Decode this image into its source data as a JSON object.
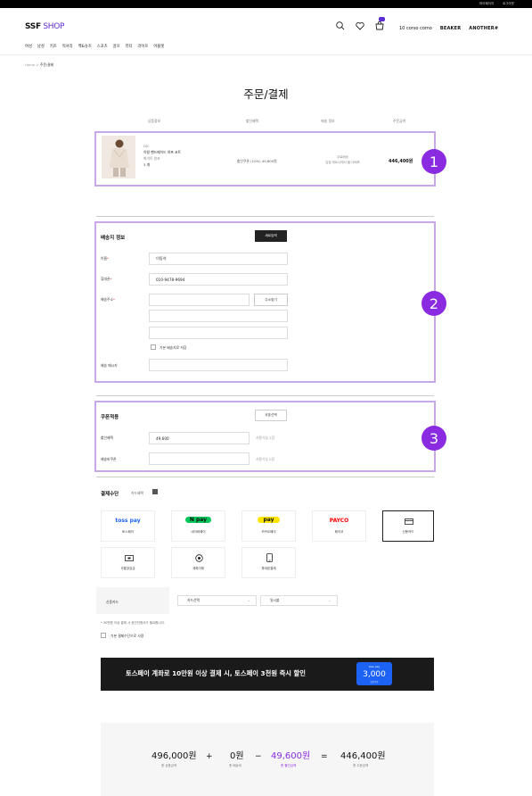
{
  "topbar": {
    "my_page": "마이페이지",
    "logout": "로그아웃"
  },
  "header": {
    "logo_bold": "SSF",
    "logo_light": " SHOP",
    "icons": [
      "search-icon",
      "heart-icon",
      "cart-icon"
    ],
    "brands": [
      "10 corso como",
      "BEAKER",
      "ANOTHER#"
    ]
  },
  "nav": [
    "여성",
    "남성",
    "키즈",
    "럭셔리",
    "백&슈즈",
    "스포츠",
    "골프",
    "뷰티",
    "라이프",
    "아울렛"
  ],
  "breadcrumb": {
    "home": "Home",
    "sep": ">",
    "current": "주문/결제"
  },
  "page_title": "주문/결제",
  "table_head": [
    "상품정보",
    "할인혜택",
    "배송 정보",
    "주문금액"
  ],
  "product": {
    "brand": "DJC",
    "name": "이탈 핸드메이드 하프 코트",
    "option": "화이트 원코",
    "qty": "1 개",
    "discount": "할인쿠폰 (10%) 49,600원",
    "ship_line1": "무료배송",
    "ship_line2": "입점 파트너에서 몰 다배포",
    "total": "446,400원"
  },
  "markers": [
    "1",
    "2",
    "3"
  ],
  "shipping": {
    "title": "배송지 정보",
    "new_button": "새로입력",
    "name_label": "이름",
    "name_value": "이동석",
    "phone_label": "휴대폰",
    "phone_value": "010-9478-9694",
    "address_label": "배송주소",
    "find_address_button": "주소찾기",
    "save_default_label": "기본 배송지로 저장",
    "message_label": "배송 메시지"
  },
  "coupon": {
    "title": "쿠폰적용",
    "select_button": "쿠폰선택",
    "discount_label": "할인혜택",
    "discount_value": "49,600",
    "discount_hint": "사용가능 2장",
    "ship_coupon_label": "배송비쿠폰",
    "ship_coupon_hint": "사용가능 0장"
  },
  "payment": {
    "title": "결제수단",
    "sub": "카드혜택",
    "toss_badge": "3천원 할인",
    "methods": [
      {
        "logo": "toss pay",
        "name": "토스페이",
        "color": "#1c63f5"
      },
      {
        "logo": "N pay",
        "name": "네이버페이",
        "color": "#03c75a"
      },
      {
        "logo": "pay",
        "name": "카카오페이",
        "color": "#fee500"
      },
      {
        "logo": "PAYCO",
        "name": "페이코",
        "color": "#ff0000"
      },
      {
        "logo": "card-icon",
        "name": "신용카드",
        "color": "#222222"
      },
      {
        "logo": "deposit-icon",
        "name": "무통장입금",
        "color": "#222222"
      },
      {
        "logo": "transfer-icon",
        "name": "계좌이체",
        "color": "#222222"
      },
      {
        "logo": "phone-icon",
        "name": "휴대폰결제",
        "color": "#222222"
      }
    ],
    "card_label": "신용카드",
    "card_select": "카드선택",
    "installment": "일시불",
    "note": "* 30만원 이상 결제 시 공인인증서가 필요합니다.",
    "default_method_label": "기본 결제수단으로 사용"
  },
  "banner": {
    "text": "토스페이 계좌로 10만원 이상 결제 시, 토스페이 3천원 즉시 할인",
    "coupon_top": "toss pay",
    "coupon_amount": "3,000",
    "coupon_bottom": "할인쿠폰"
  },
  "summary": {
    "product_total": "496,000원",
    "product_total_label": "총 상품금액",
    "plus": "+",
    "shipping": "0원",
    "shipping_label": "총 배송비",
    "minus": "−",
    "discount": "49,600원",
    "discount_label": "총 할인금액",
    "equals": "=",
    "order_total": "446,400원",
    "order_total_label": "총 주문금액"
  }
}
